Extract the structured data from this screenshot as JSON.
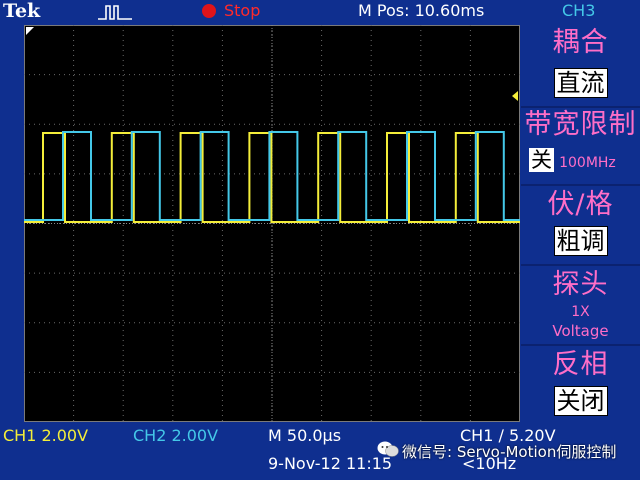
{
  "topbar": {
    "brand": "Tek",
    "trigger_icon": "trigger-pulse-icon",
    "status": "Stop",
    "m_pos": "M Pos: 10.60ms",
    "channel": "CH3"
  },
  "menu": {
    "coupling_label": "耦合",
    "coupling_value": "直流",
    "bw_label": "带宽限制",
    "bw_value_box": "关",
    "bw_value": "100MHz",
    "volts_label": "伏/格",
    "volts_value": "粗调",
    "probe_label": "探头",
    "probe_value_1": "1X",
    "probe_value_2": "Voltage",
    "invert_label": "反相",
    "invert_value": "关闭"
  },
  "bottom": {
    "ch1": "CH1  2.00V",
    "ch2": "CH2  2.00V",
    "timebase": "M 50.0µs",
    "trigger": "CH1 ∕ 5.20V",
    "date": "9-Nov-12 11:15",
    "freq": "<10Hz",
    "watermark": "微信号: Servo-Motion伺服控制"
  },
  "colors": {
    "background": "#0f2f8f",
    "screen": "#000000",
    "ch1": "#f4ee3a",
    "ch2": "#44c8e8",
    "stop": "#e0141a",
    "menu_label": "#ff6ec7"
  }
}
